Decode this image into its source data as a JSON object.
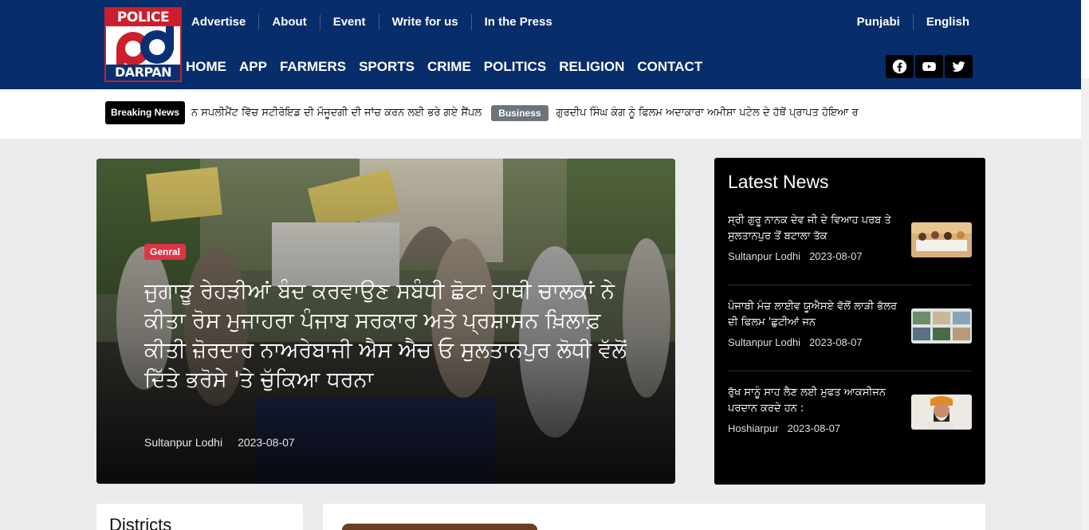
{
  "brand": {
    "top": "POLICE",
    "bottom": "DARPAN"
  },
  "topnav": [
    "Advertise",
    "About",
    "Event",
    "Write for us",
    "In the Press"
  ],
  "languages": [
    "Punjabi",
    "English"
  ],
  "mainnav": [
    "HOME",
    "APP",
    "FARMERS",
    "SPORTS",
    "CRIME",
    "POLITICS",
    "RELIGION",
    "CONTACT"
  ],
  "social": [
    "facebook-icon",
    "youtube-icon",
    "twitter-icon"
  ],
  "ticker": {
    "label": "Breaking News",
    "item1": "ਨ ਸਪਲੀਮੈਂਟ ਵਿੱਚ ਸਟੀਰੋਇਡ ਦੀ ਮੌਜੂਦਗੀ ਦੀ ਜਾਂਚ ਕਰਨ ਲਈ ਭਰੇ ਗਏ ਸੈਂਪਲ",
    "category": "Business",
    "item2": "ਗੁਰਦੀਪ ਸਿੰਘ ਕੰਗ ਨੂੰ ਫਿਲਮ ਅਦਾਕਾਰਾ ਅਮੀਸ਼ਾ ਪਟੇਲ ਦੇ ਹੱਥੋਂ ਪ੍ਰਾਪਤ ਹੋਇਆ ਰ"
  },
  "hero": {
    "category": "Genral",
    "title": "ਜੁਗਾੜੂ ਰੇਹੜੀਆਂ ਬੰਦ ਕਰਵਾਉਣ ਸਬੰਧੀ ਛੋਟਾ ਹਾਥੀ ਚਾਲਕਾਂ ਨੇ ਕੀਤਾ ਰੋਸ ਮੁਜਾਹਰਾ ਪੰਜਾਬ ਸਰਕਾਰ ਅਤੇ ਪ੍ਰਸ਼ਾਸਨ ਖ਼ਿਲਾਫ਼ ਕੀਤੀ ਜ਼ੋਰਦਾਰ ਨਾਅਰੇਬਾਜੀ ਐਸ ਐਚ ਓ ਸੁਲਤਾਨਪੁਰ ਲੋਧੀ ਵੱਲੋਂ ਦਿੱਤੇ ਭਰੋਸੇ 'ਤੇ ਚੁੱਕਿਆ ਧਰਨਾ",
    "location": "Sultanpur Lodhi",
    "date": "2023-08-07"
  },
  "latest": {
    "title": "Latest News",
    "items": [
      {
        "text": "ਸ੍ਰੀ ਗੁਰੂ ਨਾਨਕ ਦੇਵ ਜੀ ਦੇ ਵਿਆਹ ਪਰਬ ਤੇ ਸੁਲਤਾਨਪੁਰ ਤੋਂ ਬਟਾਲਾ ਤੱਕ",
        "location": "Sultanpur Lodhi",
        "date": "2023-08-07"
      },
      {
        "text": "ਪੰਜਾਬੀ ਮੰਚ ਲਾਈਵ ਯੂਐਸਏ ਵੱਲੋਂ ਲਾੜੀ ਭੱਲਰ ਦੀ ਫਿਲਮ 'ਛੁਟੀਆਂ ਜਨ",
        "location": "Sultanpur Lodhi",
        "date": "2023-08-07"
      },
      {
        "text": "ਰੁੱਖ ਸਾਨੂੰ ਸਾਹ ਲੈਣ ਲਈ ਮੁਫਤ ਆਕਸੀਜਨ ਪਰਦਾਨ ਕਰਦੇ ਹਨ :",
        "location": "Hoshiarpur",
        "date": "2023-08-07"
      }
    ]
  },
  "districts": {
    "title": "Districts"
  }
}
